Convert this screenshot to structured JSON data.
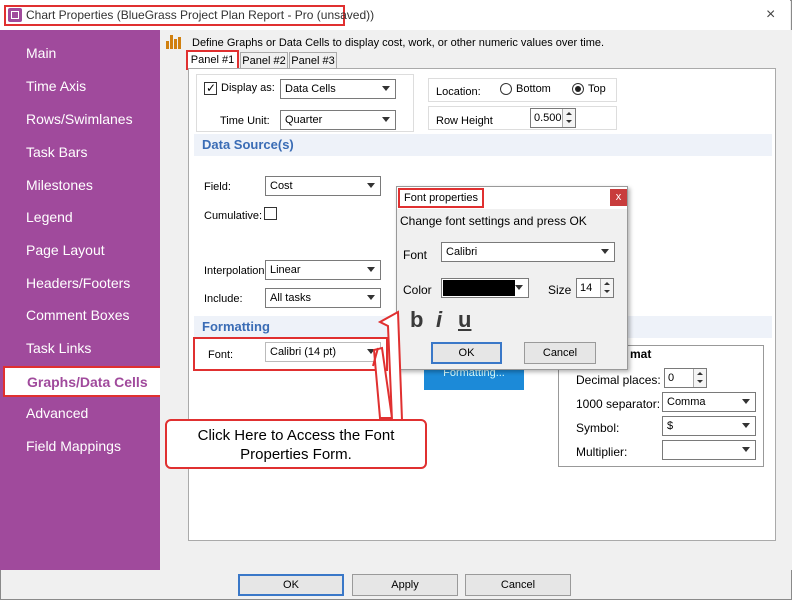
{
  "window": {
    "title": "Chart Properties (BlueGrass Project Plan Report - Pro (unsaved))",
    "close_glyph": "×"
  },
  "sidebar": {
    "items": [
      {
        "label": "Main"
      },
      {
        "label": "Time Axis"
      },
      {
        "label": "Rows/Swimlanes"
      },
      {
        "label": "Task Bars"
      },
      {
        "label": "Milestones"
      },
      {
        "label": "Legend"
      },
      {
        "label": "Page Layout"
      },
      {
        "label": "Headers/Footers"
      },
      {
        "label": "Comment Boxes"
      },
      {
        "label": "Task Links"
      },
      {
        "label": "Graphs/Data Cells"
      },
      {
        "label": "Advanced"
      },
      {
        "label": "Field Mappings"
      }
    ],
    "selected": "Graphs/Data Cells"
  },
  "content": {
    "description": "Define Graphs or Data Cells to display cost, work, or other numeric values over time.",
    "tabs": [
      {
        "label": "Panel #1"
      },
      {
        "label": "Panel #2"
      },
      {
        "label": "Panel #3"
      }
    ],
    "display_as": {
      "checked": true,
      "label": "Display as:",
      "value": "Data Cells"
    },
    "time_unit": {
      "label": "Time Unit:",
      "value": "Quarter"
    },
    "location": {
      "label": "Location:",
      "options": [
        {
          "label": "Bottom",
          "selected": false
        },
        {
          "label": "Top",
          "selected": true
        }
      ]
    },
    "row_height": {
      "label": "Row Height",
      "value": "0.500"
    },
    "data_source": {
      "title": "Data Source(s)",
      "field": {
        "label": "Field:",
        "value": "Cost"
      },
      "cumulative": {
        "label": "Cumulative:",
        "checked": false
      },
      "interpolation": {
        "label": "Interpolation:",
        "value": "Linear"
      },
      "include": {
        "label": "Include:",
        "value": "All tasks"
      }
    },
    "formatting": {
      "title": "Formatting",
      "font": {
        "label": "Font:",
        "value": "Calibri (14 pt)"
      },
      "formatting_button": "Formatting...",
      "number_format_title": "mat",
      "decimal_places": {
        "label": "Decimal places:",
        "value": "0"
      },
      "separator": {
        "label": "1000 separator:",
        "value": "Comma"
      },
      "symbol": {
        "label": "Symbol:",
        "value": "$"
      },
      "multiplier": {
        "label": "Multiplier:",
        "value": ""
      }
    }
  },
  "font_dialog": {
    "title": "Font properties",
    "close_glyph": "x",
    "instruction": "Change font settings and press OK",
    "font_label": "Font",
    "font_value": "Calibri",
    "color_label": "Color",
    "color_value": "#000000",
    "size_label": "Size",
    "size_value": "14",
    "bold_glyph": "b",
    "italic_glyph": "i",
    "underline_glyph": "u",
    "ok": "OK",
    "cancel": "Cancel"
  },
  "callout": {
    "text": "Click Here to Access the Font Properties Form.",
    "accent": "#e03030"
  },
  "footer": {
    "ok": "OK",
    "apply": "Apply",
    "cancel": "Cancel"
  },
  "colors": {
    "sidebar": "#a04a9c",
    "section_title": "#3a6cb5",
    "highlight": "#e03030"
  }
}
